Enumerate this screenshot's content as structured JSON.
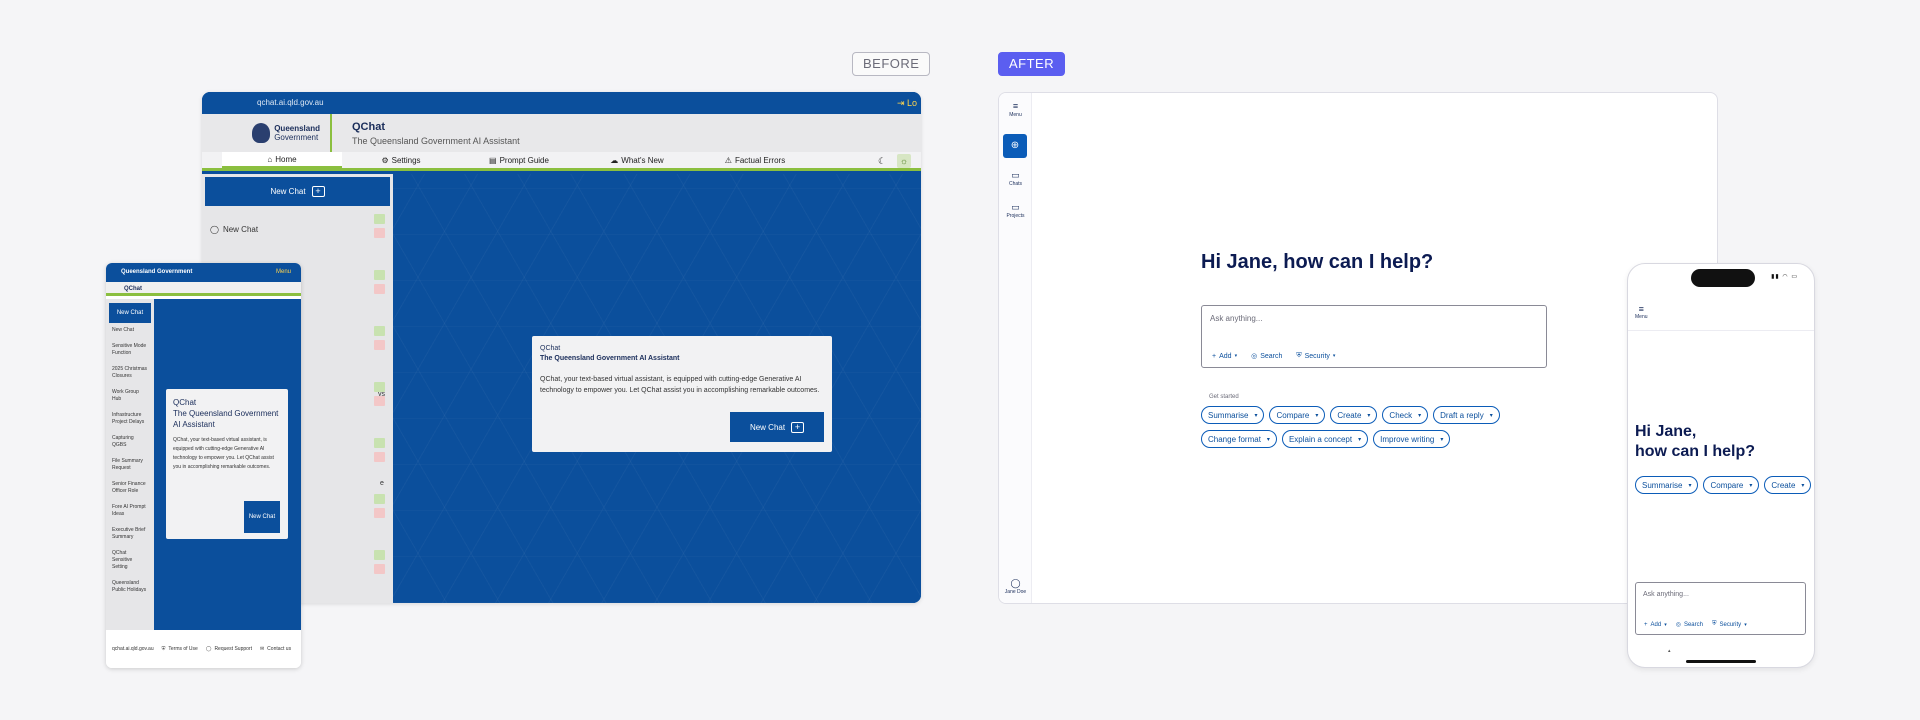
{
  "labels": {
    "before": "BEFORE",
    "after": "AFTER"
  },
  "before_desktop": {
    "url": "qchat.ai.qld.gov.au",
    "logout": "Lo",
    "logo_line1": "Queensland",
    "logo_line2": "Government",
    "app_title": "QChat",
    "app_subtitle": "The Queensland Government AI Assistant",
    "nav": [
      {
        "label": "Home",
        "icon": "⌂"
      },
      {
        "label": "Settings",
        "icon": "⚙"
      },
      {
        "label": "Prompt Guide",
        "icon": "▤"
      },
      {
        "label": "What's New",
        "icon": "☁"
      },
      {
        "label": "Factual Errors",
        "icon": "⚠"
      }
    ],
    "new_chat": "New Chat",
    "side_item": "New Chat",
    "side_partial_1": "ys",
    "side_partial_2": "e",
    "card": {
      "title": "QChat",
      "subtitle": "The Queensland Government AI Assistant",
      "body": "QChat, your text-based virtual assistant, is equipped with cutting-edge Generative AI technology to empower you. Let QChat assist you in accomplishing remarkable outcomes.",
      "button": "New Chat"
    }
  },
  "before_mobile": {
    "brand": "Queensland Government",
    "menu": "Menu",
    "title": "QChat",
    "new_chat": "New Chat",
    "items": [
      "New Chat",
      "Sensitive Mode Function",
      "2025 Christmas Closures",
      "Work Group Hub",
      "Infrastructure Project Delays",
      "Capturing QGBS",
      "File Summary Request",
      "Senior Finance Officer Role",
      "Fore AI Prompt Ideas",
      "Executive Brief Summary",
      "QChat Sensitive Setting",
      "Queensland Public Holidays"
    ],
    "card": {
      "title": "QChat\nThe Queensland Government AI Assistant",
      "title_1": "QChat",
      "title_2": "The Queensland Government AI Assistant",
      "body": "QChat, your text-based virtual assistant, is equipped with cutting-edge Generative AI technology to empower you. Let QChat assist you in accomplishing remarkable outcomes.",
      "button": "New Chat"
    },
    "footer": {
      "url": "qchat.ai.qld.gov.au",
      "terms": "Terms of Use",
      "support": "Request Support",
      "contact": "Contact us"
    }
  },
  "after_desktop": {
    "rail": {
      "menu": "Menu",
      "chats": "Chats",
      "projects": "Projects",
      "user": "Jane Doe"
    },
    "greeting": "Hi Jane, how can I help?",
    "input_placeholder": "Ask anything...",
    "tools": {
      "add": "Add",
      "search": "Search",
      "security": "Security"
    },
    "get_started": "Get started",
    "chips_row1": [
      "Summarise",
      "Compare",
      "Create",
      "Check",
      "Draft a reply"
    ],
    "chips_row2": [
      "Change format",
      "Explain a concept",
      "Improve writing"
    ]
  },
  "after_mobile": {
    "menu": "Menu",
    "greeting_1": "Hi Jane,",
    "greeting_2": "how can I help?",
    "chips": [
      "Summarise",
      "Compare",
      "Create"
    ],
    "input_placeholder": "Ask anything...",
    "tools": {
      "add": "Add",
      "search": "Search",
      "security": "Security"
    }
  },
  "colors": {
    "qld_blue": "#0b4f9c",
    "qld_green": "#8bbf3f",
    "accent": "#5b5ef0",
    "navy_text": "#0c1b52"
  }
}
